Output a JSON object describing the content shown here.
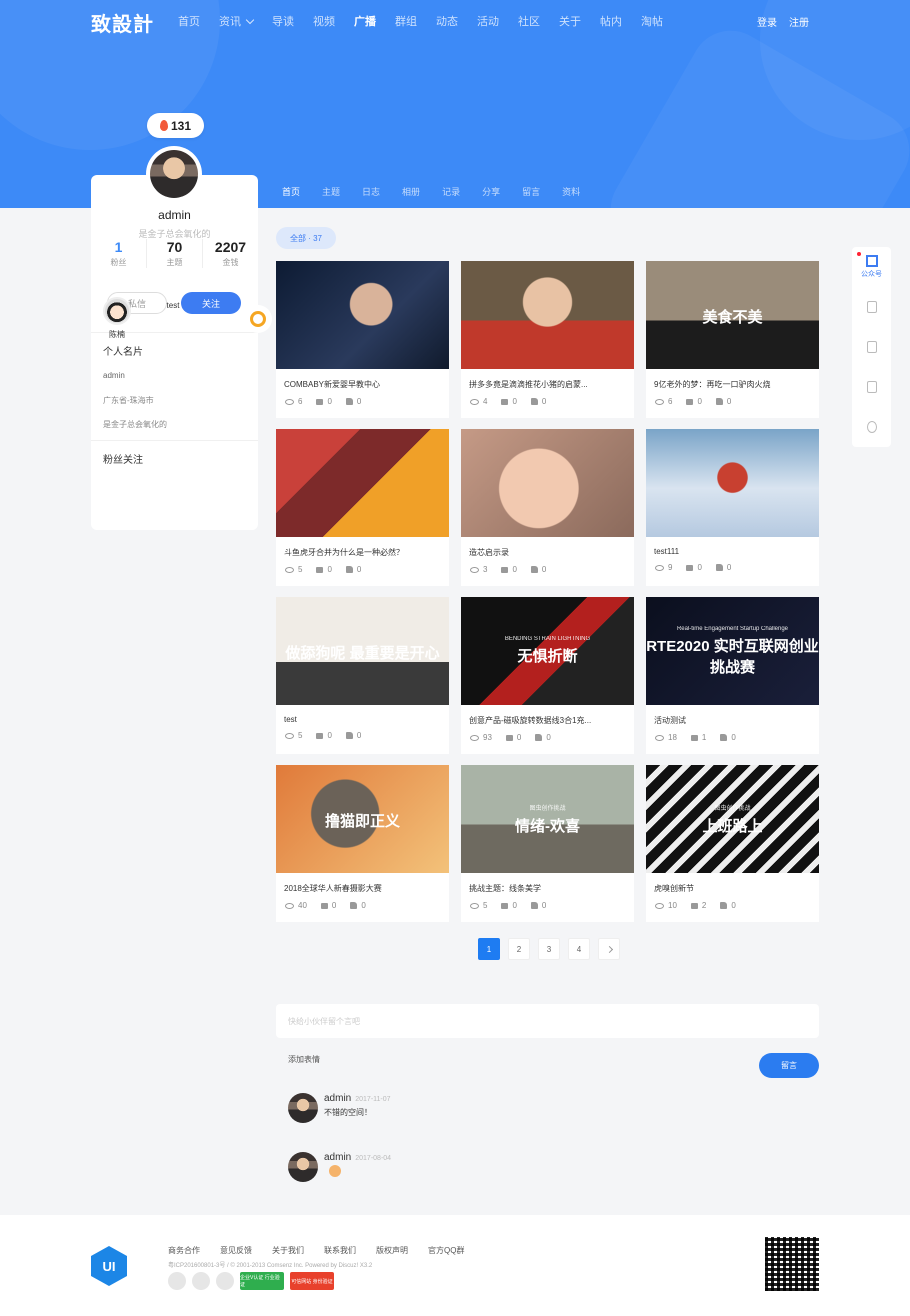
{
  "site": {
    "logo": "致設計",
    "nav": [
      {
        "label": "首页",
        "active": false
      },
      {
        "label": "资讯",
        "active": false,
        "has_dropdown": true
      },
      {
        "label": "导读",
        "active": false
      },
      {
        "label": "视频",
        "active": false
      },
      {
        "label": "广播",
        "active": true
      },
      {
        "label": "群组",
        "active": false
      },
      {
        "label": "动态",
        "active": false
      },
      {
        "label": "活动",
        "active": false
      },
      {
        "label": "社区",
        "active": false
      },
      {
        "label": "关于",
        "active": false
      },
      {
        "label": "帖内",
        "active": false
      },
      {
        "label": "淘帖",
        "active": false
      }
    ],
    "login": "登录",
    "register": "注册",
    "accent": "#3d8af7"
  },
  "profile": {
    "heat": "131",
    "name": "admin",
    "signature": "是金子总会氧化的",
    "stats": [
      {
        "value": "1",
        "label": "粉丝"
      },
      {
        "value": "70",
        "label": "主题"
      },
      {
        "value": "2207",
        "label": "金钱"
      }
    ],
    "message_btn": "私信",
    "follow_btn": "关注",
    "card_title": "个人名片",
    "card_name": "admin",
    "card_location": "广东省-珠海市",
    "card_signature": "是金子总会氧化的",
    "fans_title": "粉丝关注",
    "fans": [
      {
        "name": "陈楠"
      },
      {
        "name": "test"
      }
    ]
  },
  "profile_tabs": [
    "首页",
    "主题",
    "日志",
    "相册",
    "记录",
    "分享",
    "留言",
    "资料"
  ],
  "filter_label": "全部 · 37",
  "cards": [
    {
      "title": "COMBABY新爱婴早教中心",
      "views": "6",
      "comments": "0",
      "likes": "0",
      "overlay_small": "",
      "overlay_big": ""
    },
    {
      "title": "拼多多竟是滴滴推花小猪的启蒙...",
      "views": "4",
      "comments": "0",
      "likes": "0",
      "overlay_small": "",
      "overlay_big": ""
    },
    {
      "title": "9亿老外的梦：再吃一口驴肉火烧",
      "views": "6",
      "comments": "0",
      "likes": "0",
      "overlay_small": "",
      "overlay_big": "美食不美"
    },
    {
      "title": "斗鱼虎牙合并为什么是一种必然？",
      "views": "5",
      "comments": "0",
      "likes": "0",
      "overlay_small": "",
      "overlay_big": ""
    },
    {
      "title": "造芯启示录",
      "views": "3",
      "comments": "0",
      "likes": "0",
      "overlay_small": "",
      "overlay_big": ""
    },
    {
      "title": "test111",
      "views": "9",
      "comments": "0",
      "likes": "0",
      "overlay_small": "",
      "overlay_big": ""
    },
    {
      "title": "test",
      "views": "5",
      "comments": "0",
      "likes": "0",
      "overlay_small": "",
      "overlay_big": "做舔狗呢 最重要是开心"
    },
    {
      "title": "创意产品-磁吸旋转数据线3合1充...",
      "views": "93",
      "comments": "0",
      "likes": "0",
      "overlay_small": "BENDING STRAIN LIGHTNING",
      "overlay_big": "无惧折断"
    },
    {
      "title": "活动测试",
      "views": "18",
      "comments": "1",
      "likes": "0",
      "overlay_small": "Real-time Engagement Startup Challenge",
      "overlay_big": "RTE2020 实时互联网创业挑战赛"
    },
    {
      "title": "2018全球华人新春摄影大赛",
      "views": "40",
      "comments": "0",
      "likes": "0",
      "overlay_small": "",
      "overlay_big": "撸猫即正义"
    },
    {
      "title": "挑战主题：线条美学",
      "views": "5",
      "comments": "0",
      "likes": "0",
      "overlay_small": "图虫创作挑战",
      "overlay_big": "情绪-欢喜"
    },
    {
      "title": "虎嗅创新节",
      "views": "10",
      "comments": "2",
      "likes": "0",
      "overlay_small": "图虫创作挑战",
      "overlay_big": "上班路上"
    }
  ],
  "pagination": {
    "pages": [
      "1",
      "2",
      "3",
      "4"
    ],
    "current": "1"
  },
  "comment_form": {
    "placeholder": "快给小伙伴留个言吧",
    "add_emoji": "添加表情",
    "submit": "留言"
  },
  "comments": [
    {
      "user": "admin",
      "date": "2017-11-07",
      "text": "不错的空间！"
    },
    {
      "user": "admin",
      "date": "2017-08-04",
      "text": ""
    }
  ],
  "footer": {
    "links": [
      "商务合作",
      "意见反馈",
      "关于我们",
      "联系我们",
      "版权声明",
      "官方QQ群"
    ],
    "copyright": "粤ICP201600801-3号 / © 2001-2013 Comsenz Inc. Powered by Discuz! X3.2",
    "logo_text": "UI",
    "badge1": "企业V认证 行业验证",
    "badge2": "可信网站 身份验证"
  },
  "right_bar": {
    "gzh_label": "公众号"
  }
}
